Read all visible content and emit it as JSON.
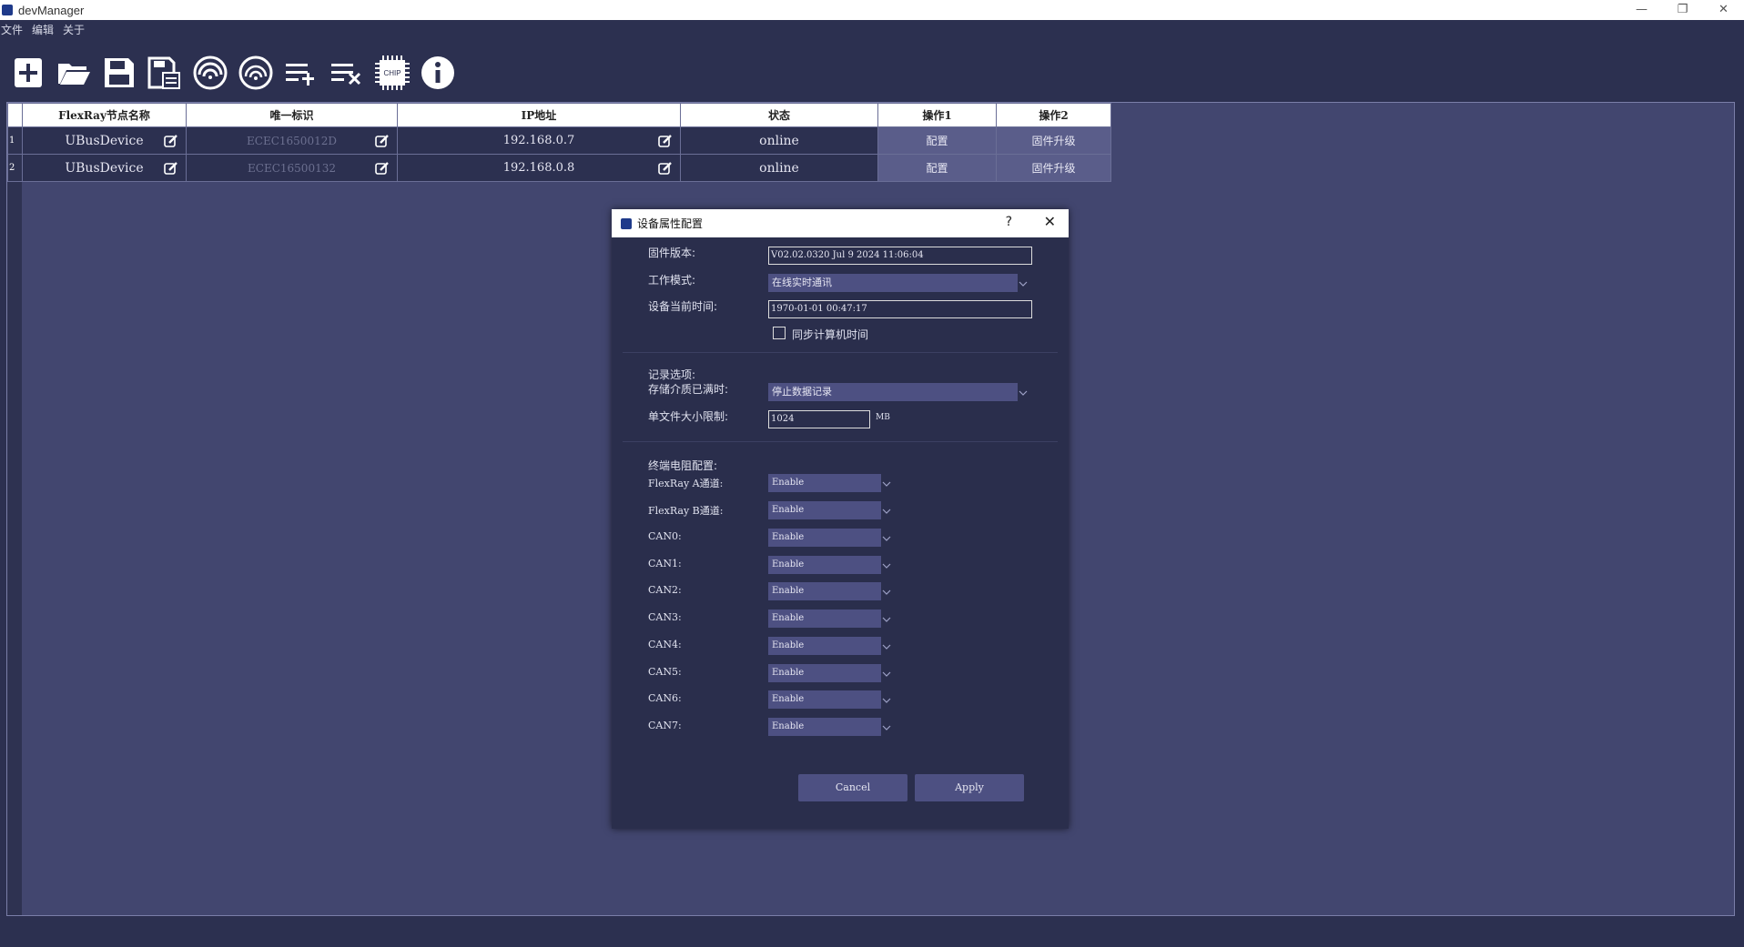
{
  "window": {
    "title": "devManager"
  },
  "menu": {
    "items": [
      "文件",
      "编辑",
      "关于"
    ]
  },
  "toolbar": {
    "icons": [
      "new-document-icon",
      "open-folder-icon",
      "save-icon",
      "save-as-icon",
      "scan-device-icon",
      "scan-network-icon",
      "add-list-icon",
      "remove-list-icon",
      "chip-icon",
      "info-icon"
    ],
    "chip_label": "CHIP"
  },
  "table": {
    "headers": [
      "FlexRay节点名称",
      "唯一标识",
      "IP地址",
      "状态",
      "操作1",
      "操作2"
    ],
    "rows": [
      {
        "num": "1",
        "name": "UBusDevice",
        "uid": "ECEC1650012D",
        "ip": "192.168.0.7",
        "status": "online",
        "op1": "配置",
        "op2": "固件升级"
      },
      {
        "num": "2",
        "name": "UBusDevice",
        "uid": "ECEC16500132",
        "ip": "192.168.0.8",
        "status": "online",
        "op1": "配置",
        "op2": "固件升级"
      }
    ]
  },
  "dialog": {
    "title": "设备属性配置",
    "help": "?",
    "firmware_label": "固件版本:",
    "firmware_value": "V02.02.0320 Jul  9 2024 11:06:04",
    "mode_label": "工作模式:",
    "mode_value": "在线实时通讯",
    "time_label": "设备当前时间:",
    "time_value": "1970-01-01 00:47:17",
    "sync_label": "同步计算机时间",
    "record_label": "记录选项:",
    "storage_label": "存储介质已满时:",
    "storage_value": "停止数据记录",
    "filesize_label": "单文件大小限制:",
    "filesize_value": "1024",
    "filesize_unit": "MB",
    "term_label": "终端电阻配置:",
    "channels": [
      {
        "label": "FlexRay A通道:",
        "value": "Enable"
      },
      {
        "label": "FlexRay B通道:",
        "value": "Enable"
      },
      {
        "label": "CAN0:",
        "value": "Enable"
      },
      {
        "label": "CAN1:",
        "value": "Enable"
      },
      {
        "label": "CAN2:",
        "value": "Enable"
      },
      {
        "label": "CAN3:",
        "value": "Enable"
      },
      {
        "label": "CAN4:",
        "value": "Enable"
      },
      {
        "label": "CAN5:",
        "value": "Enable"
      },
      {
        "label": "CAN6:",
        "value": "Enable"
      },
      {
        "label": "CAN7:",
        "value": "Enable"
      }
    ],
    "cancel": "Cancel",
    "apply": "Apply"
  },
  "colors": {
    "background": "#2c3050",
    "workspace": "#42466f",
    "dialog": "#2a2e4c",
    "button": "#5a5d8a"
  }
}
